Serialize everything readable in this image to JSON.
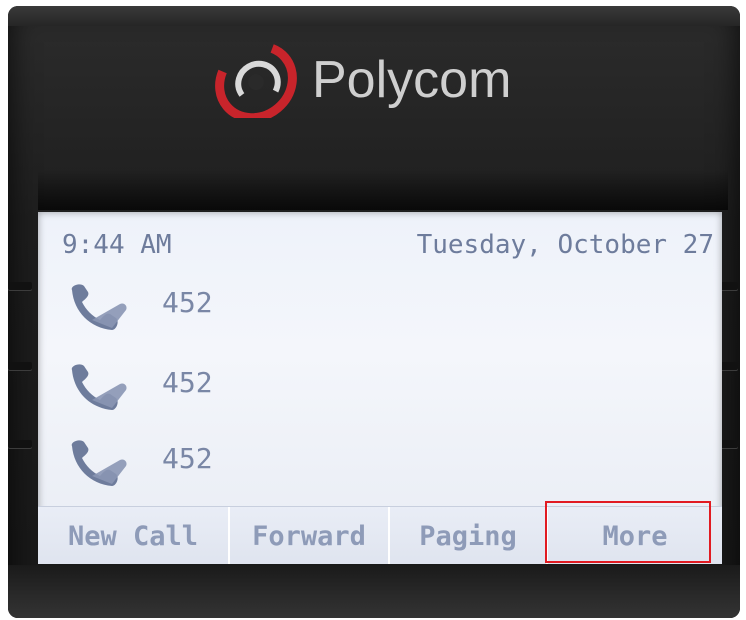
{
  "brand": {
    "name": "Polycom",
    "colors": {
      "logo_red": "#c8242b",
      "logo_text": "#cfcfcf",
      "lcd_text": "#6e7c9c",
      "highlight": "#e11b22"
    }
  },
  "status_bar": {
    "time": "9:44 AM",
    "date": "Tuesday, October 27"
  },
  "lines": [
    {
      "icon": "phone-handset-icon",
      "label": "452"
    },
    {
      "icon": "phone-handset-icon",
      "label": "452"
    },
    {
      "icon": "phone-handset-icon",
      "label": "452"
    }
  ],
  "softkeys": [
    {
      "label": "New Call"
    },
    {
      "label": "Forward"
    },
    {
      "label": "Paging"
    },
    {
      "label": "More",
      "highlighted": true
    }
  ]
}
